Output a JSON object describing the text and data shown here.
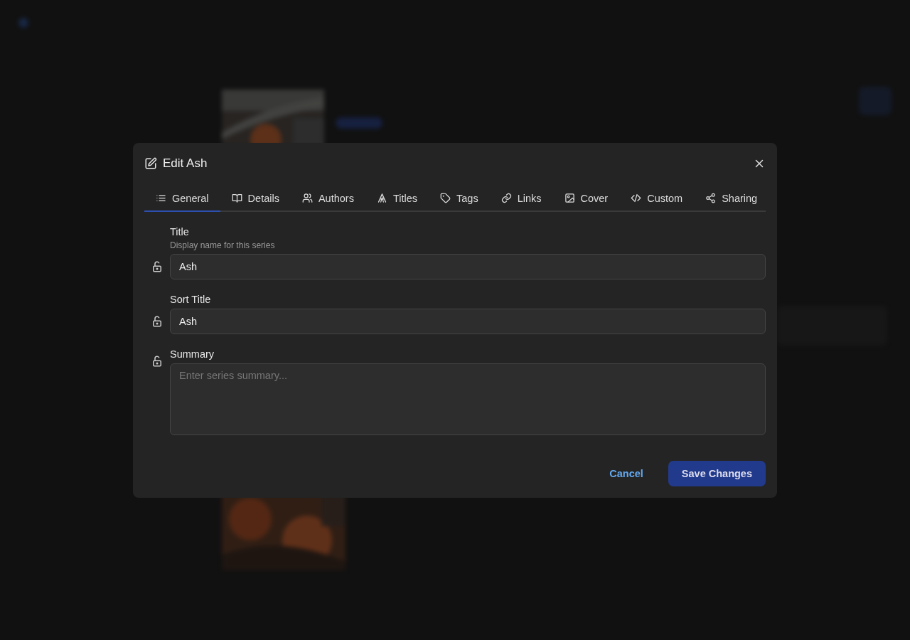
{
  "dialog": {
    "title": "Edit Ash",
    "tabs": [
      {
        "label": "General",
        "selected": true
      },
      {
        "label": "Details",
        "selected": false
      },
      {
        "label": "Authors",
        "selected": false
      },
      {
        "label": "Titles",
        "selected": false
      },
      {
        "label": "Tags",
        "selected": false
      },
      {
        "label": "Links",
        "selected": false
      },
      {
        "label": "Cover",
        "selected": false
      },
      {
        "label": "Custom",
        "selected": false
      },
      {
        "label": "Sharing",
        "selected": false
      }
    ],
    "fields": [
      {
        "kind": "input",
        "label": "Title",
        "hint": "Display name for this series",
        "value": "Ash",
        "locked": false
      },
      {
        "kind": "input",
        "label": "Sort Title",
        "value": "Ash",
        "locked": false
      },
      {
        "kind": "textarea",
        "label": "Summary",
        "placeholder": "Enter series summary...",
        "locked": false
      }
    ],
    "buttons": [
      {
        "label": "Cancel",
        "kind": "secondary"
      },
      {
        "label": "Save Changes",
        "kind": "primary"
      }
    ]
  }
}
